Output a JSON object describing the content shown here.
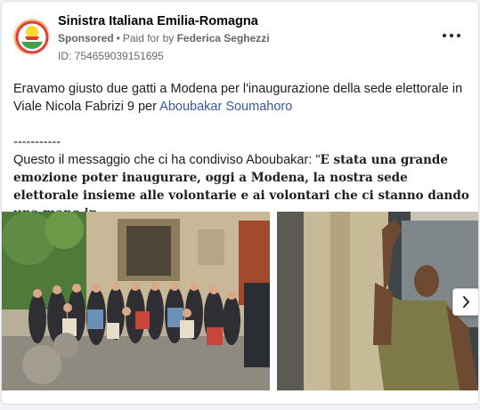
{
  "ad": {
    "page_name": "Sinistra Italiana Emilia-Romagna",
    "sponsored_label": "Sponsored",
    "separator": "•",
    "paid_for_label": "Paid for by",
    "payer_name": "Federica Seghezzi",
    "ad_id": "ID: 754659039151695",
    "more_icon": "more-horizontal-icon"
  },
  "post": {
    "text_part1": "Eravamo giusto due gatti a Modena per l'inaugurazione della sede elettorale in Viale Nicola Fabrizi 9 per ",
    "tagged_name": "Aboubakar Soumahoro",
    "divider": "-----------",
    "quote_intro": "Questo il messaggio che ci ha condiviso Aboubakar: \"",
    "quote_bold": "E stata una grande emozione poter inaugurare, oggi a Modena, la nostra sede elettorale insieme alle volontarie e ai volontari che ci stanno dando una mano in…"
  },
  "carousel": {
    "next_icon": "chevron-right-icon",
    "photos": [
      {
        "name": "group-photo"
      },
      {
        "name": "raised-fist-photo"
      }
    ]
  },
  "colors": {
    "link": "#385898",
    "muted": "#65676b",
    "text": "#1c1e21"
  }
}
